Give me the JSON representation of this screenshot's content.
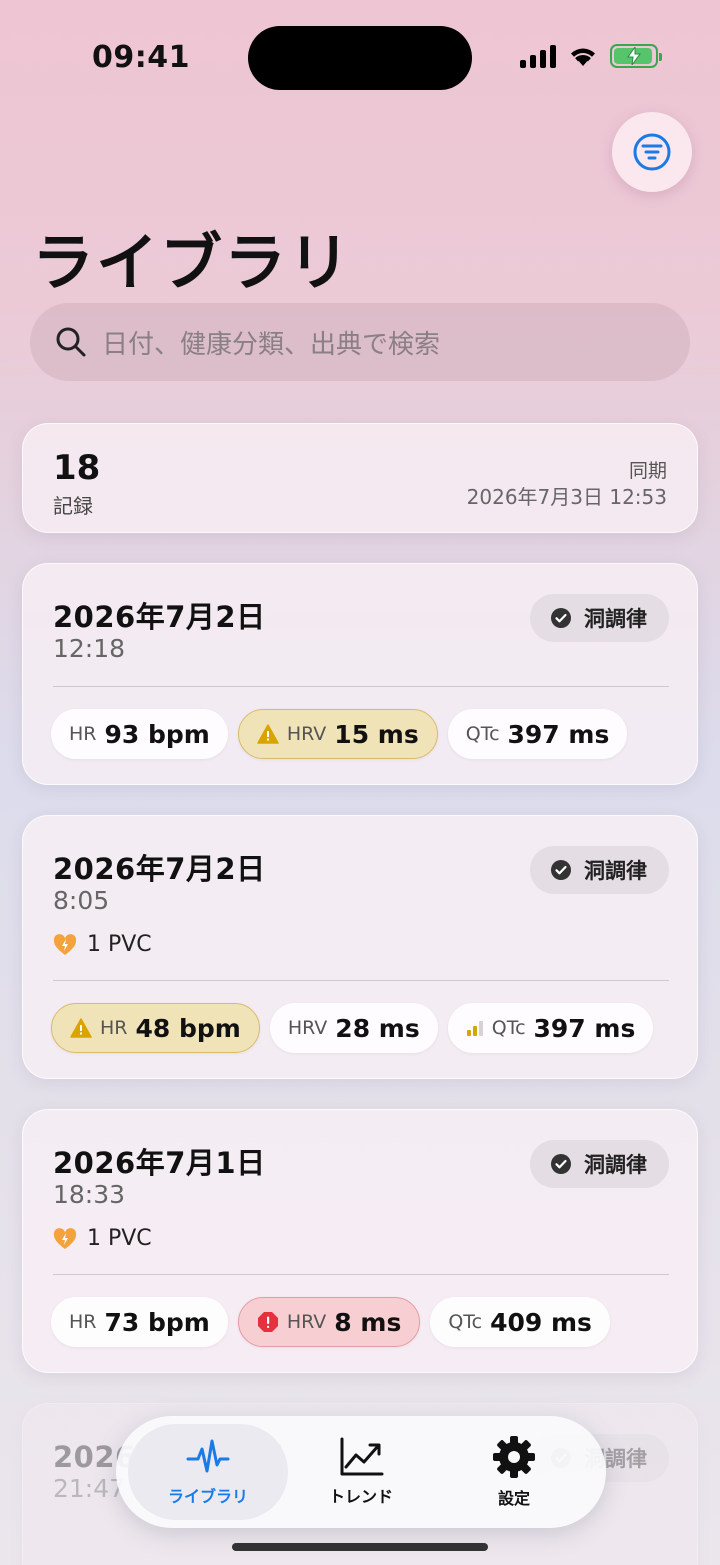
{
  "status": {
    "time": "09:41"
  },
  "page": {
    "title": "ライブラリ"
  },
  "search": {
    "placeholder": "日付、健康分類、出典で検索"
  },
  "summary": {
    "count": "18",
    "count_label": "記録",
    "sync_label": "同期",
    "sync_date": "2026年7月3日 12:53"
  },
  "records": [
    {
      "date": "2026年7月2日",
      "time": "12:18",
      "rhythm": "洞調律",
      "chips": [
        {
          "label": "HR",
          "value": "93 bpm",
          "status": "normal"
        },
        {
          "label": "HRV",
          "value": "15 ms",
          "status": "warning"
        },
        {
          "label": "QTc",
          "value": "397 ms",
          "status": "normal"
        }
      ]
    },
    {
      "date": "2026年7月2日",
      "time": "8:05",
      "rhythm": "洞調律",
      "pvc": "1 PVC",
      "chips": [
        {
          "label": "HR",
          "value": "48 bpm",
          "status": "warning"
        },
        {
          "label": "HRV",
          "value": "28 ms",
          "status": "normal"
        },
        {
          "label": "QTc",
          "value": "397 ms",
          "status": "trend"
        }
      ]
    },
    {
      "date": "2026年7月1日",
      "time": "18:33",
      "rhythm": "洞調律",
      "pvc": "1 PVC",
      "chips": [
        {
          "label": "HR",
          "value": "73 bpm",
          "status": "normal"
        },
        {
          "label": "HRV",
          "value": "8 ms",
          "status": "alert"
        },
        {
          "label": "QTc",
          "value": "409 ms",
          "status": "normal"
        }
      ]
    },
    {
      "date": "2026年6月30日",
      "time": "21:47",
      "rhythm": "洞調律"
    }
  ],
  "tabs": [
    {
      "label": "ライブラリ",
      "icon": "waveform-icon",
      "active": true
    },
    {
      "label": "トレンド",
      "icon": "chart-line-icon",
      "active": false
    },
    {
      "label": "設定",
      "icon": "gear-icon",
      "active": false
    }
  ],
  "colors": {
    "accent": "#1a7ae6",
    "warning": "#d9a400",
    "alert": "#e5303d",
    "pvc": "#f4a23c",
    "battery": "#38a84f"
  }
}
